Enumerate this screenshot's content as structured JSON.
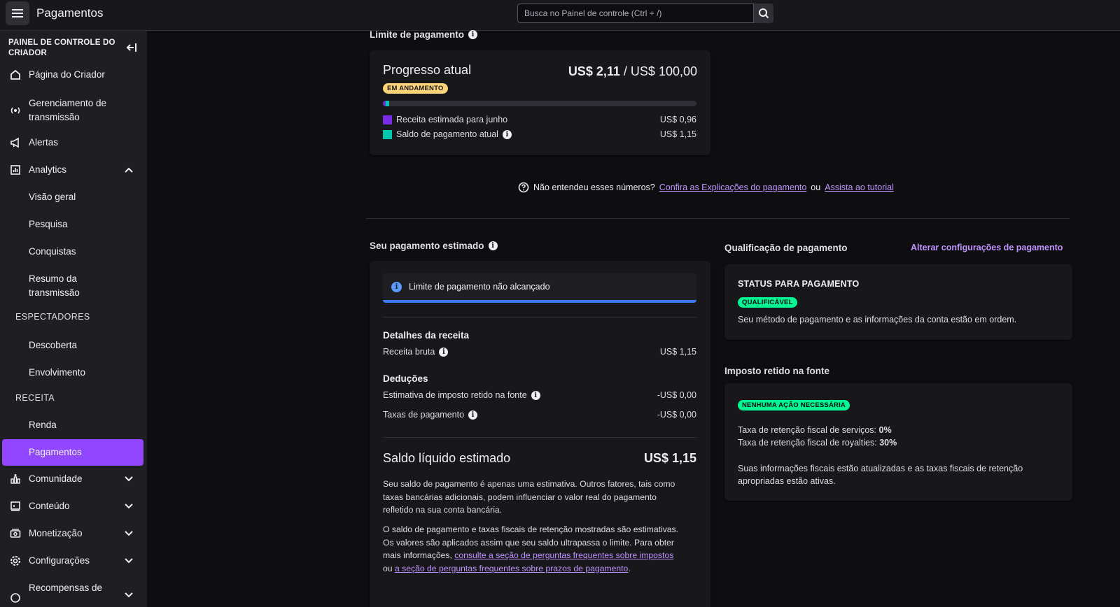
{
  "topbar": {
    "title": "Pagamentos",
    "search_placeholder": "Busca no Painel de controle (Ctrl + /)"
  },
  "sidebar": {
    "header": "PAINEL DE CONTROLE DO CRIADOR",
    "items": [
      {
        "label": "Página do Criador",
        "icon": "home-icon"
      },
      {
        "label": "Gerenciamento de transmissão",
        "icon": "broadcast-icon"
      },
      {
        "label": "Alertas",
        "icon": "megaphone-icon"
      },
      {
        "label": "Analytics",
        "icon": "analytics-icon",
        "expanded": true
      },
      {
        "label": "Visão geral"
      },
      {
        "label": "Pesquisa"
      },
      {
        "label": "Conquistas"
      },
      {
        "label": "Resumo da transmissão"
      },
      {
        "label": "Descoberta"
      },
      {
        "label": "Envolvimento"
      },
      {
        "label": "Renda"
      },
      {
        "label": "Pagamentos",
        "active": true
      },
      {
        "label": "Comunidade",
        "icon": "community-icon"
      },
      {
        "label": "Conteúdo",
        "icon": "content-icon"
      },
      {
        "label": "Monetização",
        "icon": "monetization-icon"
      },
      {
        "label": "Configurações",
        "icon": "settings-icon"
      },
      {
        "label": "Recompensas de",
        "icon": "rewards-icon"
      }
    ],
    "sections": {
      "viewers": "ESPECTADORES",
      "revenue": "RECEITA"
    }
  },
  "payout_limit": {
    "section_title": "Limite de pagamento",
    "card_title": "Progresso atual",
    "badge": "EM ANDAMENTO",
    "current_amount": "US$ 2,11",
    "separator": "/",
    "limit_amount": "US$ 100,00",
    "progress_fraction": 0.0211,
    "legend": [
      {
        "label": "Receita estimada para junho",
        "value": "US$ 0,96",
        "color": "#772ce8"
      },
      {
        "label": "Saldo de pagamento atual",
        "value": "US$ 1,15",
        "color": "#00c8af"
      }
    ]
  },
  "help": {
    "question": "Não entendeu esses números?",
    "link1": "Confira as Explicações do pagamento",
    "or": "ou",
    "link2": "Assista ao tutorial"
  },
  "estimated": {
    "section_title": "Seu pagamento estimado",
    "alert": "Limite de pagamento não alcançado",
    "revenue_details_title": "Detalhes da receita",
    "gross_label": "Receita bruta",
    "gross_value": "US$ 1,15",
    "deductions_title": "Deduções",
    "tax_label": "Estimativa de imposto retido na fonte",
    "tax_value": "-US$ 0,00",
    "fees_label": "Taxas de pagamento",
    "fees_value": "-US$ 0,00",
    "net_label": "Saldo líquido estimado",
    "net_value": "US$ 1,15",
    "para1": "Seu saldo de pagamento é apenas uma estimativa. Outros fatores, tais como taxas bancárias adicionais, podem influenciar o valor real do pagamento refletido na sua conta bancária.",
    "para2_text": "O saldo de pagamento e taxas fiscais de retenção mostradas são estimativas. Os valores são aplicados assim que seu saldo ultrapassa o limite. Para obter mais informações,",
    "para2_link1": "consulte a seção de perguntas frequentes sobre impostos",
    "para2_or": "ou",
    "para2_link2": "a seção de perguntas frequentes sobre prazos de pagamento",
    "para2_end": "."
  },
  "qualification": {
    "section_title": "Qualificação de pagamento",
    "change_link": "Alterar configurações de pagamento",
    "status_title": "STATUS PARA PAGAMENTO",
    "badge": "QUALIFICÁVEL",
    "text": "Seu método de pagamento e as informações da conta estão em ordem."
  },
  "tax": {
    "section_title": "Imposto retido na fonte",
    "badge": "NENHUMA AÇÃO NECESSÁRIA",
    "services_label": "Taxa de retenção fiscal de serviços:",
    "services_value": "0%",
    "royalties_label": "Taxa de retenção fiscal de royalties:",
    "royalties_value": "30%",
    "text": "Suas informações fiscais estão atualizadas e as taxas fiscais de retenção apropriadas estão ativas."
  }
}
